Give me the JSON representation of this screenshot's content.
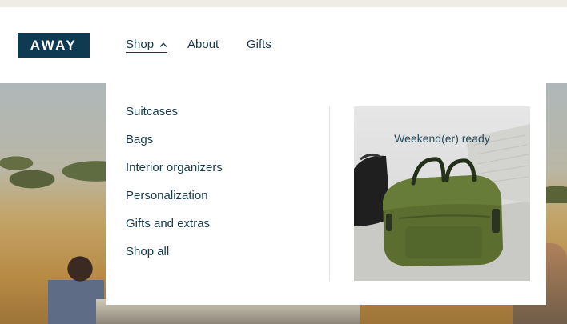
{
  "brand": {
    "logo_text": "AWAY",
    "color": "#0f3b52"
  },
  "nav": {
    "shop_label": "Shop",
    "about_label": "About",
    "gifts_label": "Gifts",
    "shop_expanded_icon": "chevron-up-icon"
  },
  "dropdown": {
    "items": [
      {
        "label": "Suitcases"
      },
      {
        "label": "Bags"
      },
      {
        "label": "Interior organizers"
      },
      {
        "label": "Personalization"
      },
      {
        "label": "Gifts and extras"
      },
      {
        "label": "Shop all"
      }
    ],
    "promo": {
      "title": "Weekend(er) ready",
      "image": "green-duffel-bag-on-bed"
    }
  },
  "colors": {
    "text": "#163a4a",
    "top_strip": "#efece6",
    "bag_green": "#5b6e30"
  }
}
